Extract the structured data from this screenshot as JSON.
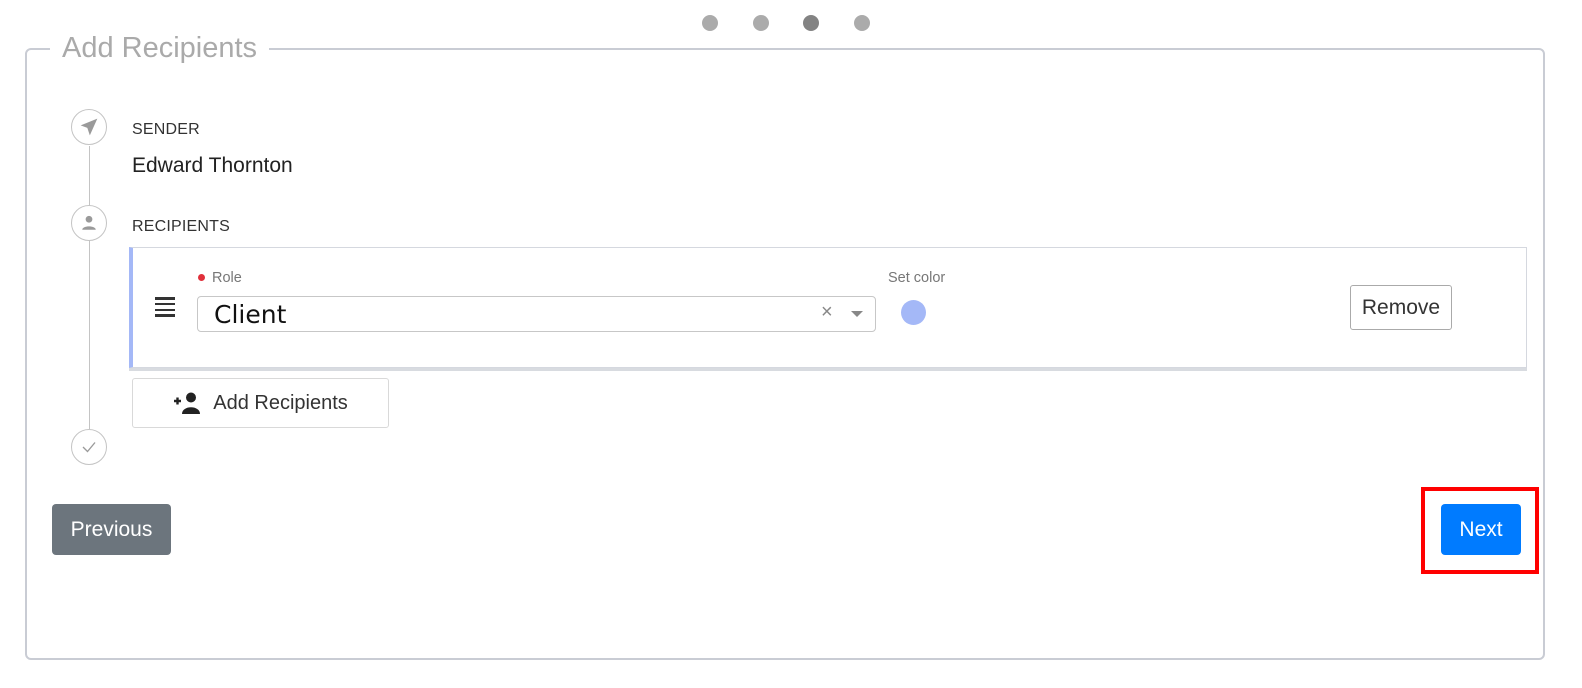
{
  "pagination": {
    "total_steps": 4,
    "active_step": 3
  },
  "section": {
    "title": "Add Recipients"
  },
  "timeline": {
    "icons": [
      "send-icon",
      "person-icon",
      "check-icon"
    ]
  },
  "sender": {
    "label": "SENDER",
    "name": "Edward Thornton"
  },
  "recipients": {
    "label": "RECIPIENTS",
    "items": [
      {
        "role_label": "Role",
        "role_required": true,
        "role_value": "Client",
        "clear_symbol": "×",
        "color_label": "Set color",
        "color": "#a4b8f7",
        "remove_label": "Remove"
      }
    ],
    "add_label": "Add Recipients"
  },
  "navigation": {
    "previous_label": "Previous",
    "next_label": "Next"
  },
  "colors": {
    "primary": "#007bff",
    "secondary": "#6c757d",
    "required": "#e0303b",
    "highlight": "#ff0000"
  }
}
